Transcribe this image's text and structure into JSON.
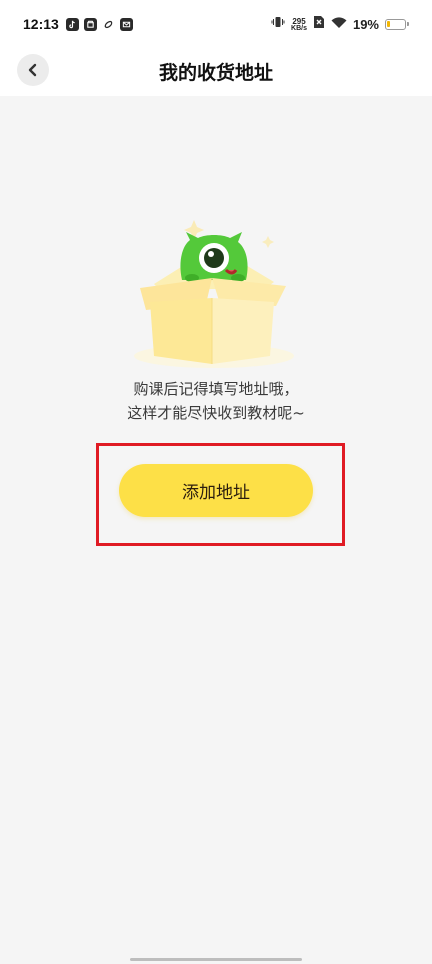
{
  "status_bar": {
    "time": "12:13",
    "app_icons": [
      "tiktok-icon",
      "store-icon",
      "link-icon",
      "mail-icon"
    ],
    "net_speed_value": "295",
    "net_speed_unit": "KB/s",
    "battery_percent": "19%",
    "battery_level": 0.19,
    "battery_color": "#f2b705"
  },
  "header": {
    "title": "我的收货地址"
  },
  "empty_state": {
    "line1": "购课后记得填写地址哦，",
    "line2": "这样才能尽快收到教材呢~",
    "add_button_label": "添加地址"
  },
  "colors": {
    "accent": "#fde047",
    "highlight": "#e01b24",
    "background": "#f5f5f5"
  }
}
